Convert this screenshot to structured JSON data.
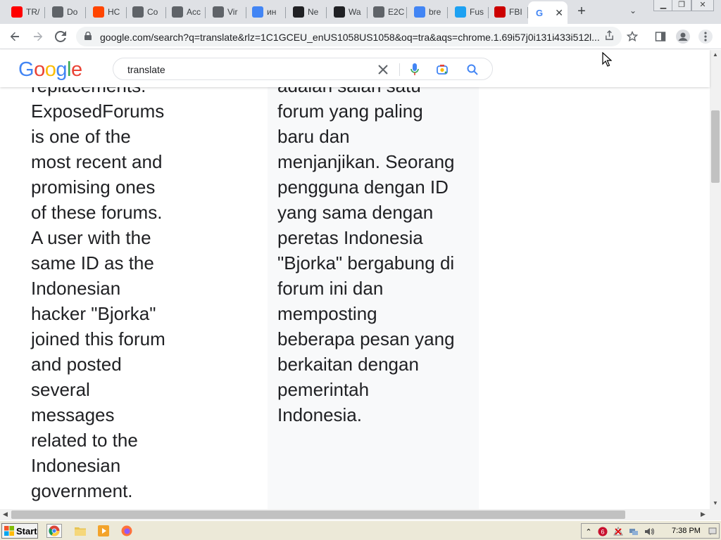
{
  "tabs": [
    {
      "label": "TR/",
      "icon": "youtube-icon",
      "color": "#ff0000"
    },
    {
      "label": "Do",
      "icon": "globe-icon",
      "color": "#5f6368"
    },
    {
      "label": "HC",
      "icon": "reddit-icon",
      "color": "#ff4500"
    },
    {
      "label": "Co",
      "icon": "spy-icon",
      "color": "#5f6368"
    },
    {
      "label": "Acc",
      "icon": "spy-icon",
      "color": "#5f6368"
    },
    {
      "label": "Vir",
      "icon": "globe-icon",
      "color": "#5f6368"
    },
    {
      "label": "ин",
      "icon": "google-icon",
      "color": "#4285f4"
    },
    {
      "label": "Ne",
      "icon": "github-icon",
      "color": "#202124"
    },
    {
      "label": "Wa",
      "icon": "wikipedia-icon",
      "color": "#202124"
    },
    {
      "label": "E2C",
      "icon": "globe-icon",
      "color": "#5f6368"
    },
    {
      "label": "bre",
      "icon": "google-icon",
      "color": "#4285f4"
    },
    {
      "label": "Fus",
      "icon": "twitter-icon",
      "color": "#1da1f2"
    },
    {
      "label": "FBI",
      "icon": "cnn-icon",
      "color": "#cc0000"
    }
  ],
  "address_bar": {
    "url": "google.com/search?q=translate&rlz=1C1GCEU_enUS1058US1058&oq=tra&aqs=chrome.1.69i57j0i131i433i512l..."
  },
  "google": {
    "logo": [
      "G",
      "o",
      "o",
      "g",
      "l",
      "e"
    ],
    "logo_colors": [
      "#4285f4",
      "#ea4335",
      "#fbbc05",
      "#4285f4",
      "#34a853",
      "#ea4335"
    ],
    "query": "translate"
  },
  "translation": {
    "source_lines": [
      "replacements.",
      "ExposedForums",
      "is one of the",
      "most recent and",
      "promising ones",
      "of these forums.",
      "A user with the",
      "same ID as the",
      "Indonesian",
      "hacker \"Bjorka\"",
      "joined this forum",
      "and posted",
      "several",
      "messages",
      "related to the",
      "Indonesian",
      "government."
    ],
    "target_lines": [
      "adalah salah satu",
      "forum yang paling",
      "baru dan",
      "menjanjikan. Seorang",
      "pengguna dengan ID",
      "yang sama dengan",
      "peretas Indonesia",
      "\"Bjorka\" bergabung di",
      "forum ini dan",
      "memposting",
      "beberapa pesan yang",
      "berkaitan dengan",
      "pemerintah",
      "Indonesia."
    ]
  },
  "taskbar": {
    "start_label": "Start",
    "clock": "7:38 PM"
  },
  "colors": {
    "tabstrip_bg": "#dfe1e5",
    "panel_bg": "#f8f9fa",
    "taskbar_bg": "#ece9d8"
  }
}
